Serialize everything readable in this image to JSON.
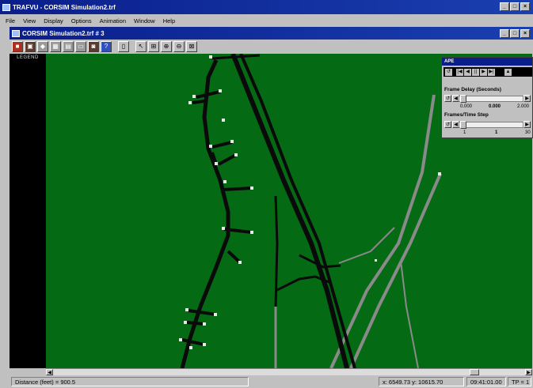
{
  "app": {
    "title": "TRAFVU - CORSIM Simulation2.trf",
    "window_buttons": [
      "_",
      "□",
      "×"
    ]
  },
  "menu": [
    "File",
    "View",
    "Display",
    "Options",
    "Animation",
    "Window",
    "Help"
  ],
  "child_window": {
    "title": "CORSIM Simulation2.trf # 3",
    "buttons": [
      "_",
      "□",
      "×"
    ]
  },
  "toolbar": {
    "tools": [
      {
        "icon": "stop-icon",
        "glyph": "■"
      },
      {
        "icon": "film-icon",
        "glyph": "▣"
      },
      {
        "icon": "vehicle-icon",
        "glyph": "◆"
      },
      {
        "icon": "grid-icon",
        "glyph": "▦"
      },
      {
        "icon": "table-icon",
        "glyph": "▤"
      },
      {
        "icon": "window-icon",
        "glyph": "▭"
      },
      {
        "icon": "camera-icon",
        "glyph": "◙"
      },
      {
        "icon": "info-icon",
        "glyph": "?"
      },
      {
        "icon": "page-icon",
        "glyph": "▯"
      },
      {
        "icon": "select-icon",
        "glyph": "↖"
      },
      {
        "icon": "zoom-extent-icon",
        "glyph": "⊞"
      },
      {
        "icon": "zoom-in-icon",
        "glyph": "⊕"
      },
      {
        "icon": "zoom-out-icon",
        "glyph": "⊖"
      },
      {
        "icon": "zoom-window-icon",
        "glyph": "⊠"
      }
    ]
  },
  "legend": {
    "title": "LEGEND"
  },
  "ape": {
    "title": "APE",
    "controls": [
      "↺",
      "|◀",
      "◀",
      "||",
      "▶",
      "▶|",
      "▲"
    ],
    "frame_delay": {
      "label": "Frame Delay (Seconds)",
      "min": "0.000",
      "current": "0.000",
      "max": "2.000",
      "fraction": 0.0
    },
    "frames_per_step": {
      "label": "Frames/Time Step",
      "min": "1",
      "current": "1",
      "max": "30",
      "fraction": 0.0
    }
  },
  "status": {
    "distance": "Distance (feet) =    900.5",
    "coords": "x:  6549.73  y:  10615.70",
    "time": "09:41:01.00",
    "tp": "TP = 1"
  },
  "colors": {
    "background": "#056a14",
    "road": "#0a0a0a",
    "ramp_gray": "#8a8a8a",
    "stop_marker": "#e8e8e8",
    "titlebar": "#0a1e8c"
  }
}
